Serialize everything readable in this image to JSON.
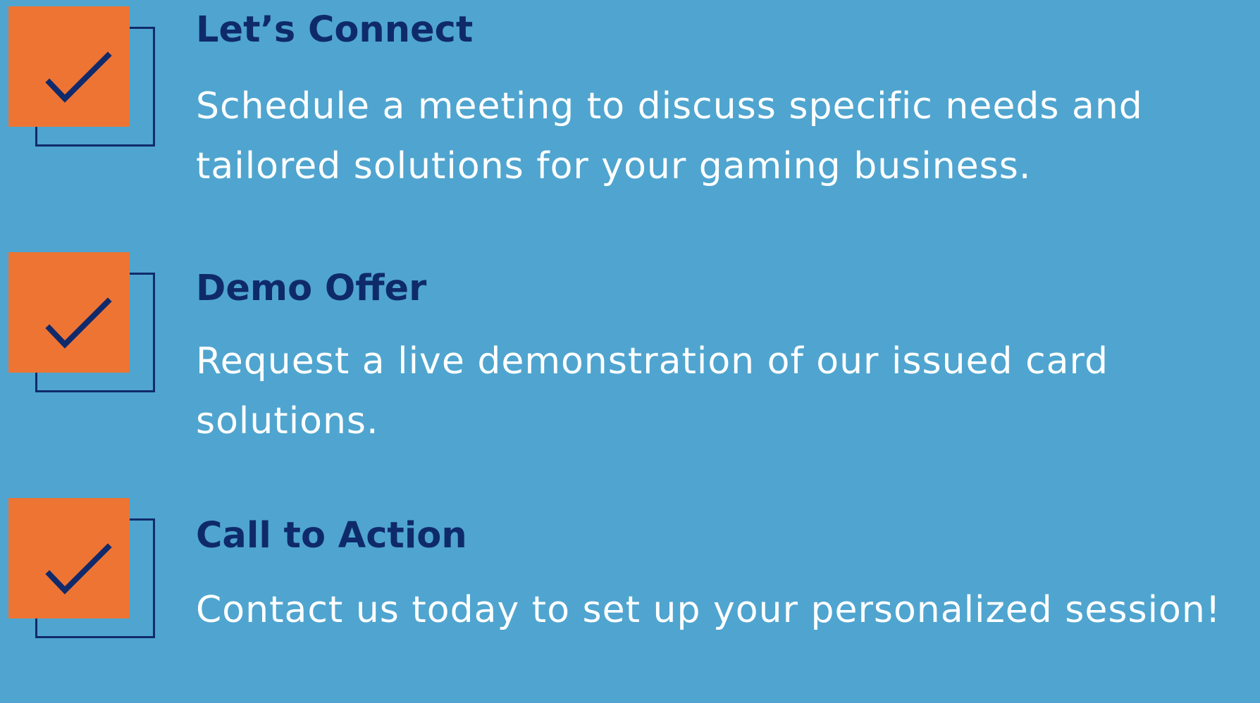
{
  "items": [
    {
      "title": "Let’s Connect",
      "description": "Schedule a meeting to discuss specific needs and tailored solutions for your gaming business.",
      "icon": "checkmark-icon"
    },
    {
      "title": "Demo Offer",
      "description": "Request a live demonstration of our issued card solutions.",
      "icon": "checkmark-icon"
    },
    {
      "title": "Call to Action",
      "description": "Contact us today to set up your personalized session!",
      "icon": "checkmark-icon"
    }
  ],
  "colors": {
    "background": "#4fa5cf",
    "orange_box": "#ee7434",
    "navy": "#102a6b",
    "title_text": "#0f2a6a",
    "body_text": "#ffffff"
  }
}
